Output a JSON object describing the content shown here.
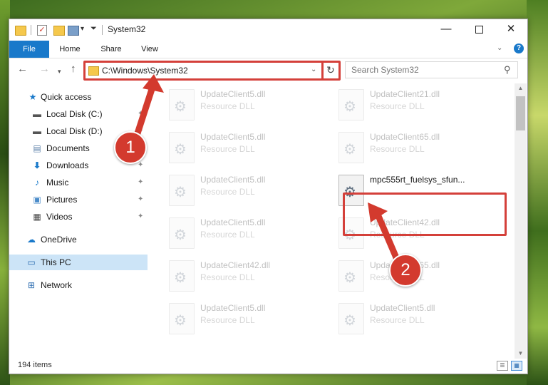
{
  "window": {
    "title": "System32",
    "controls": {
      "minimize": "—",
      "maximize": "",
      "close": "✕"
    }
  },
  "ribbon": {
    "tabs": [
      {
        "label": "File",
        "active": true
      },
      {
        "label": "Home"
      },
      {
        "label": "Share"
      },
      {
        "label": "View"
      }
    ],
    "accent": "#1979ca"
  },
  "address": {
    "path": "C:\\Windows\\System32",
    "search_placeholder": "Search System32"
  },
  "sidebar": {
    "items": [
      {
        "label": "Quick access",
        "icon": "star-icon",
        "pinned": false
      },
      {
        "label": "Local Disk (C:)",
        "icon": "drive-icon",
        "pinned": true
      },
      {
        "label": "Local Disk (D:)",
        "icon": "drive-icon",
        "pinned": true
      },
      {
        "label": "Documents",
        "icon": "documents-icon",
        "pinned": true
      },
      {
        "label": "Downloads",
        "icon": "download-icon",
        "pinned": true
      },
      {
        "label": "Music",
        "icon": "music-icon",
        "pinned": true
      },
      {
        "label": "Pictures",
        "icon": "pictures-icon",
        "pinned": true
      },
      {
        "label": "Videos",
        "icon": "videos-icon",
        "pinned": true
      },
      {
        "label": "OneDrive",
        "icon": "cloud-icon",
        "pinned": false
      },
      {
        "label": "This PC",
        "icon": "computer-icon",
        "selected": true
      },
      {
        "label": "Network",
        "icon": "network-icon"
      }
    ]
  },
  "files": [
    {
      "name": "UpdateClient5.dll",
      "type": "Resource DLL"
    },
    {
      "name": "UpdateClient21.dll",
      "type": "Resource DLL"
    },
    {
      "name": "UpdateClient5.dll",
      "type": "Resource DLL"
    },
    {
      "name": "UpdateClient65.dll",
      "type": "Resource DLL"
    },
    {
      "name": "UpdateClient5.dll",
      "type": "Resource DLL"
    },
    {
      "name": "mpc555rt_fuelsys_sfun...",
      "type": "",
      "highlighted": true
    },
    {
      "name": "UpdateClient5.dll",
      "type": "Resource DLL"
    },
    {
      "name": "UpdateClient42.dll",
      "type": "Resource DLL"
    },
    {
      "name": "UpdateClient42.dll",
      "type": "Resource DLL"
    },
    {
      "name": "UpdateClient65.dll",
      "type": "Resource DLL"
    },
    {
      "name": "UpdateClient5.dll",
      "type": "Resource DLL"
    },
    {
      "name": "UpdateClient5.dll",
      "type": "Resource DLL"
    }
  ],
  "status": {
    "item_count": "194 items"
  },
  "annotations": {
    "step1": "1",
    "step2": "2",
    "color": "#d33a2e"
  }
}
